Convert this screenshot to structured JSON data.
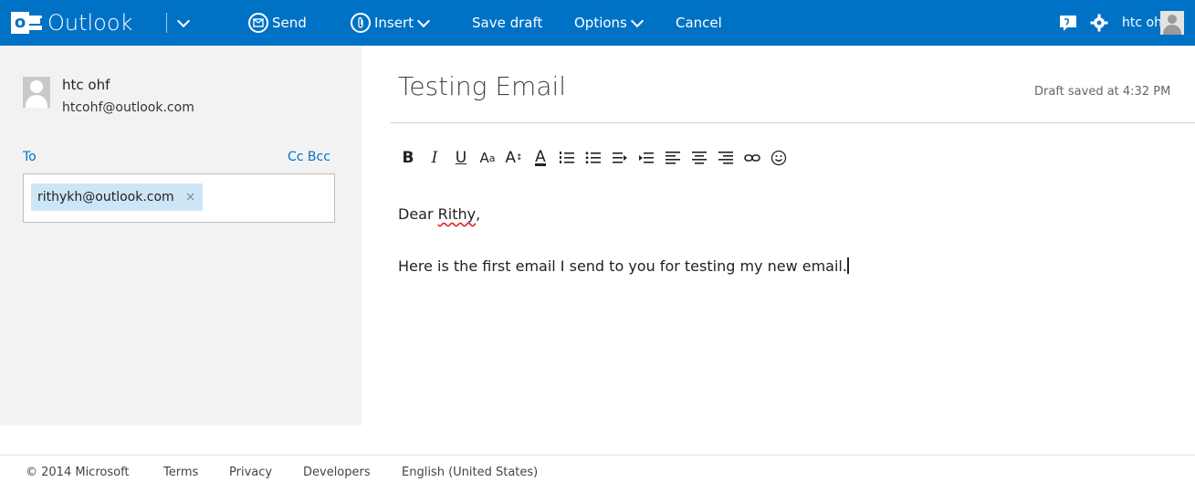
{
  "header": {
    "app_name": "Outlook",
    "send_label": "Send",
    "insert_label": "Insert",
    "save_draft_label": "Save draft",
    "options_label": "Options",
    "cancel_label": "Cancel",
    "user_name": "htc ohf",
    "bg_color": "#0072c6"
  },
  "sender": {
    "name": "htc ohf",
    "email": "htcohf@outlook.com"
  },
  "recipients": {
    "to_label": "To",
    "cc_bcc_label": "Cc Bcc",
    "to": [
      "rithykh@outlook.com"
    ],
    "remove_symbol": "×"
  },
  "compose": {
    "subject": "Testing Email",
    "draft_status": "Draft saved at 4:32 PM",
    "greeting_prefix": "Dear ",
    "greeting_name": "Rithy",
    "greeting_suffix": ",",
    "body": "Here is the first email I send to you for testing my new email."
  },
  "toolbar": {
    "icons": [
      "bold-icon",
      "italic-icon",
      "underline-icon",
      "font-size-icon",
      "grow-font-icon",
      "font-color-icon",
      "numbered-list-icon",
      "bullet-list-icon",
      "decrease-indent-icon",
      "increase-indent-icon",
      "align-left-icon",
      "align-center-icon",
      "align-right-icon",
      "link-icon",
      "emoticon-icon"
    ]
  },
  "footer": {
    "copyright": "© 2014 Microsoft",
    "terms": "Terms",
    "privacy": "Privacy",
    "developers": "Developers",
    "language": "English (United States)"
  }
}
